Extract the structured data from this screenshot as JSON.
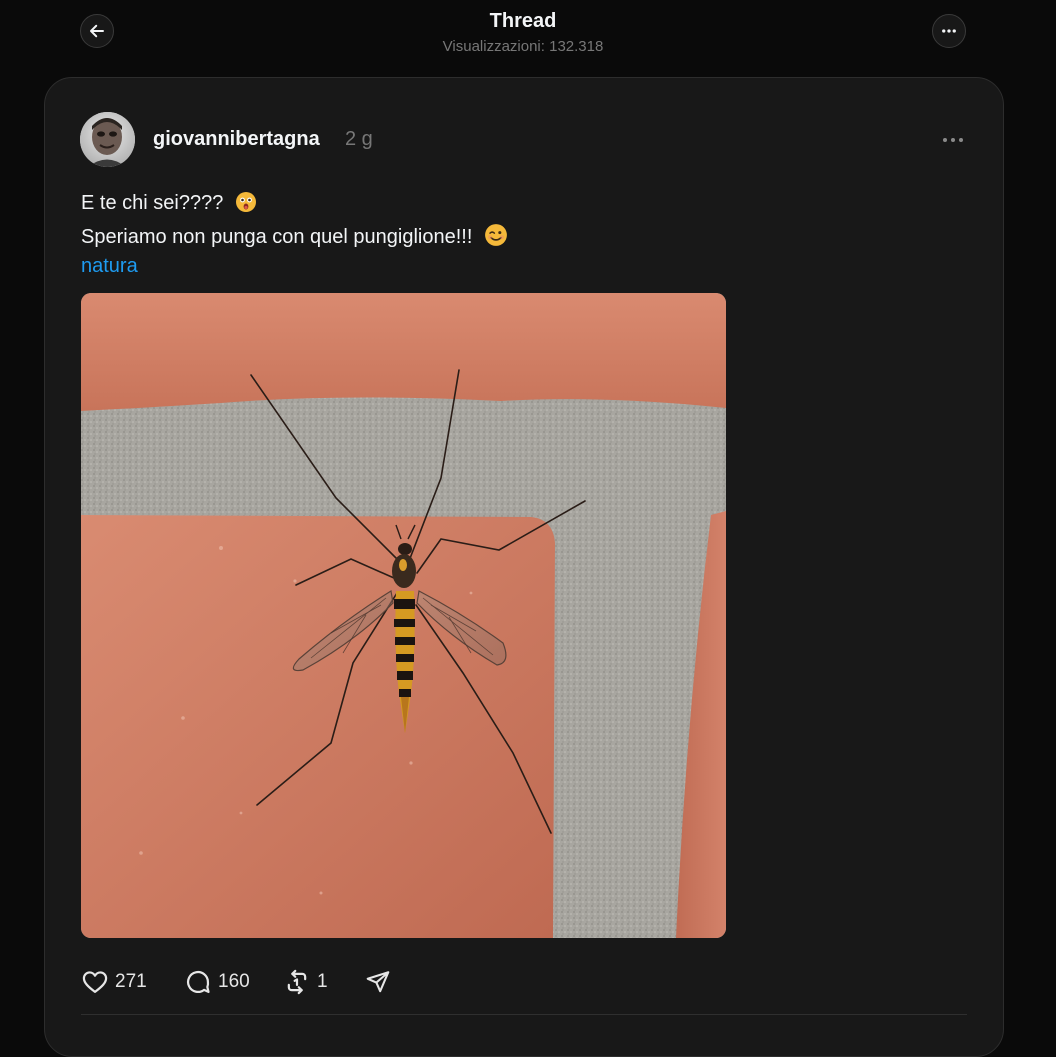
{
  "header": {
    "title": "Thread",
    "views": "Visualizzazioni: 132.318",
    "back_icon": "arrow-left-icon",
    "more_icon": "ellipsis-icon"
  },
  "post": {
    "username": "giovannibertagna",
    "time_ago": "2 g",
    "line1": "E te chi sei????",
    "line1_emoji": "astonished-face-emoji",
    "line2": "Speriamo non punga con quel pungiglione!!!",
    "line2_emoji": "winking-face-emoji",
    "tag": "natura",
    "image_subject": "crane-fly-on-terracotta-tile",
    "more_icon": "ellipsis-icon"
  },
  "actions": {
    "likes": "271",
    "replies": "160",
    "reposts": "1",
    "like_icon": "heart-icon",
    "reply_icon": "speech-bubble-icon",
    "repost_icon": "repost-icon",
    "share_icon": "send-icon"
  },
  "colors": {
    "background": "#0a0a0a",
    "card": "#181818",
    "text": "#f3f5f7",
    "muted": "#777777",
    "link": "#1e9bf0"
  }
}
